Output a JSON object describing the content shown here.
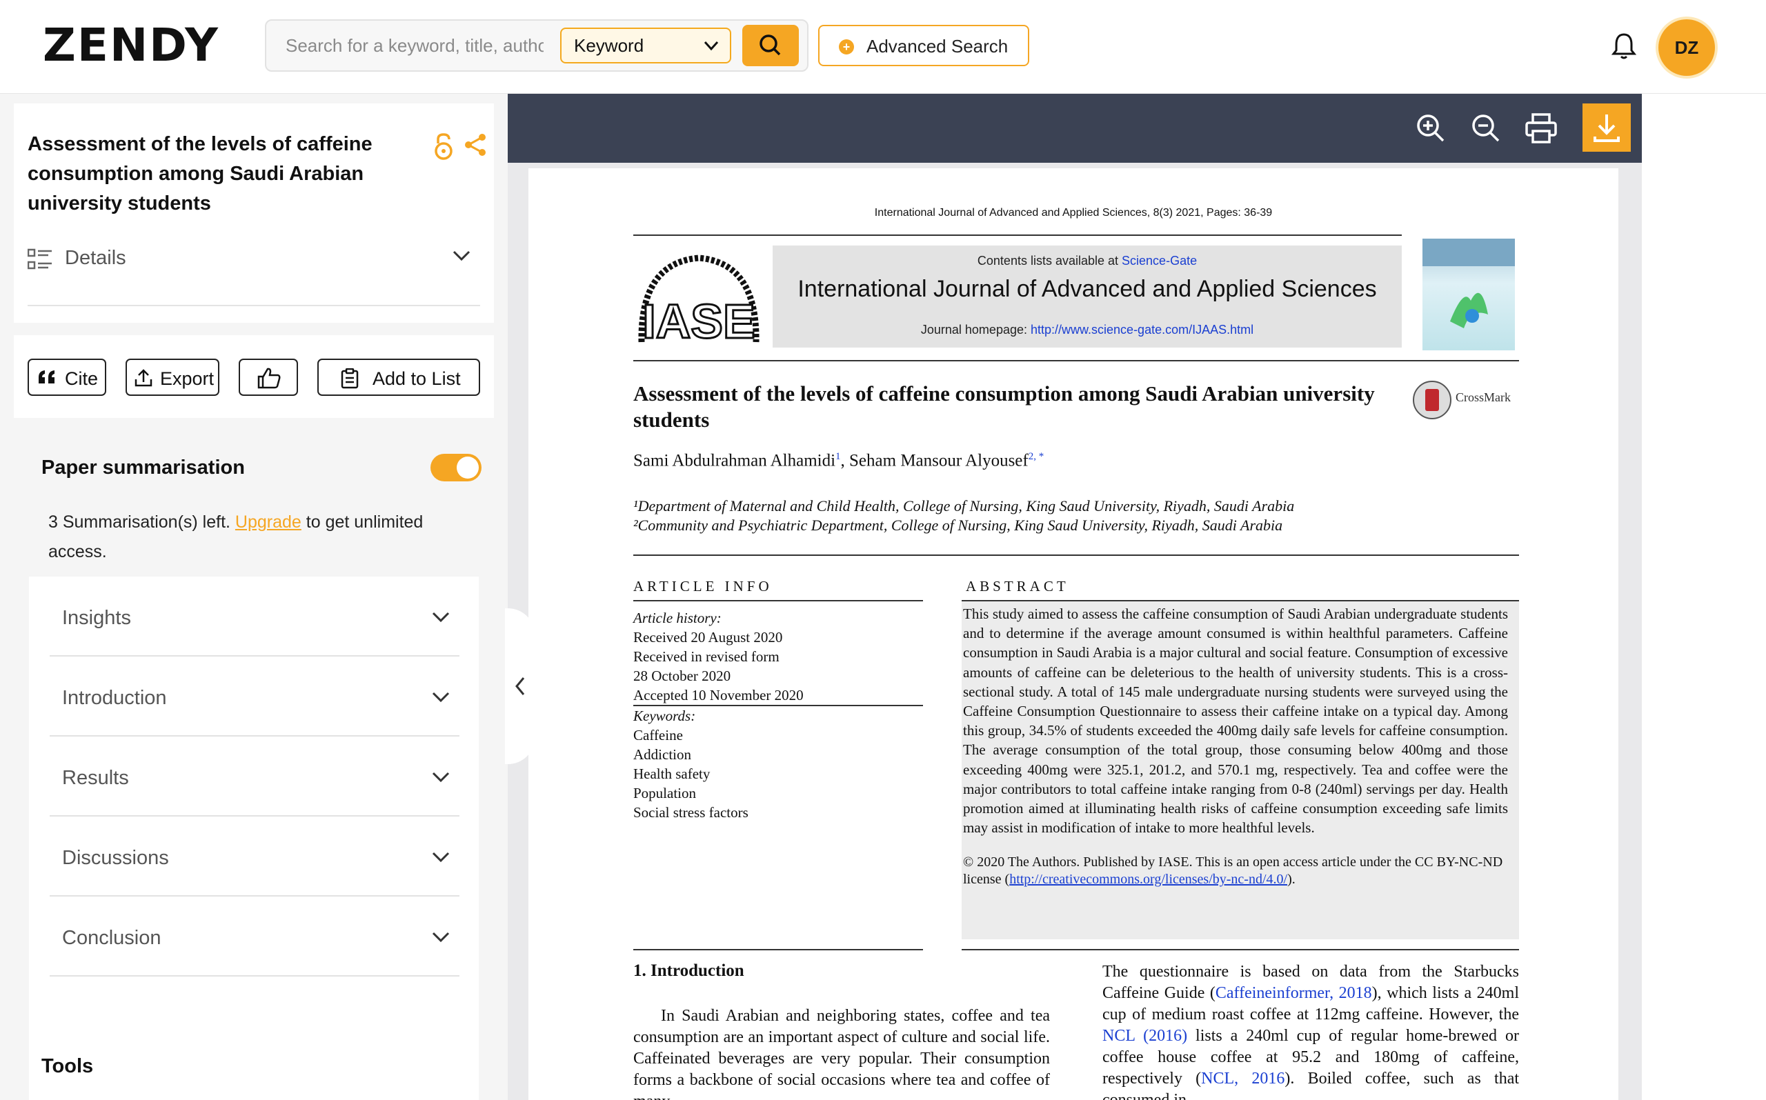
{
  "brand": {
    "logo_text": "ZENDY"
  },
  "search": {
    "placeholder": "Search for a keyword, title, author",
    "mode_selected": "Keyword",
    "advanced_label": "Advanced Search"
  },
  "user": {
    "initials": "DZ"
  },
  "doc": {
    "title": "Assessment of the levels of caffeine consumption among Saudi Arabian university students",
    "details_label": "Details"
  },
  "actions": {
    "cite_label": "Cite",
    "export_label": "Export",
    "add_to_list_label": "Add to List"
  },
  "summarisation": {
    "title": "Paper summarisation",
    "enabled": true,
    "note_prefix": "3 Summarisation(s) left.",
    "upgrade_label": "Upgrade",
    "note_suffix": "to get unlimited access.",
    "sections": [
      "Insights",
      "Introduction",
      "Results",
      "Discussions",
      "Conclusion"
    ]
  },
  "tools_label": "Tools",
  "paper": {
    "journal_top": "International Journal of Advanced and Applied Sciences, 8(3) 2021, Pages: 36-39",
    "logo_text": "IASE",
    "contents_prefix": "Contents lists available at",
    "contents_link": "Science-Gate",
    "journal_name": "International Journal of Advanced and Applied Sciences",
    "homepage_prefix": "Journal homepage:",
    "homepage_link": "http://www.science-gate.com/IJAAS.html",
    "crossmark": "CrossMark",
    "title": "Assessment of the levels of caffeine consumption among Saudi Arabian university students",
    "author1": "Sami Abdulrahman Alhamidi",
    "author1_sup": "1",
    "author2": "Seham Mansour Alyousef",
    "author2_sup": "2, *",
    "affil1": "¹Department of Maternal and Child Health, College of Nursing, King Saud University, Riyadh, Saudi Arabia",
    "affil2": "²Community and Psychiatric Department, College of Nursing, King Saud University, Riyadh, Saudi Arabia",
    "article_info_head": "ARTICLE INFO",
    "abstract_head": "ABSTRACT",
    "history_label": "Article history:",
    "history": [
      "Received 20 August 2020",
      "Received in revised form",
      "28 October 2020",
      "Accepted 10 November 2020"
    ],
    "keywords_label": "Keywords:",
    "keywords": [
      "Caffeine",
      "Addiction",
      "Health safety",
      "Population",
      "Social stress factors"
    ],
    "abstract": "This study aimed to assess the caffeine consumption of Saudi Arabian undergraduate students and to determine if the average amount consumed is within healthful parameters. Caffeine consumption in Saudi Arabia is a major cultural and social feature. Consumption of excessive amounts of caffeine can be deleterious to the health of university students. This is a cross-sectional study. A total of 145 male undergraduate nursing students were surveyed using the Caffeine Consumption Questionnaire to assess their caffeine intake on a typical day. Among this group, 34.5% of students exceeded the 400mg daily safe levels for caffeine consumption. The average consumption of the total group, those consuming below 400mg and those exceeding 400mg were 325.1, 201.2, and 570.1 mg, respectively. Tea and coffee were the major contributors to total caffeine intake ranging from 0-8 (240ml) servings per day. Health promotion aimed at illuminating health risks of caffeine consumption exceeding safe limits may assist in modification of intake to more healthful levels.",
    "license_prefix": "© 2020 The Authors. Published by IASE. This is an open access article under the CC BY-NC-ND license (",
    "license_link": "http://creativecommons.org/licenses/by-nc-nd/4.0/",
    "license_suffix": ").",
    "intro_heading": "1. Introduction",
    "intro_left": "In Saudi Arabian and neighboring states, coffee and tea consumption are an important aspect of culture and social life. Caffeinated beverages are very popular. Their consumption forms a backbone of social occasions where tea and coffee of many",
    "intro_right_a": "The questionnaire is based on data from the Starbucks Caffeine Guide (",
    "intro_right_link1": "Caffeineinformer, 2018",
    "intro_right_b": "), which lists a 240ml cup of medium roast coffee at 112mg caffeine. However, the ",
    "intro_right_link2": "NCL (2016)",
    "intro_right_c": " lists a 240ml cup of regular home-brewed or coffee house coffee at 95.2 and 180mg of caffeine, respectively (",
    "intro_right_link3": "NCL, 2016",
    "intro_right_d": "). Boiled coffee, such as that consumed in"
  },
  "colors": {
    "accent": "#f5a623",
    "toolbar": "#3b4254",
    "link": "#1a3fd1"
  }
}
